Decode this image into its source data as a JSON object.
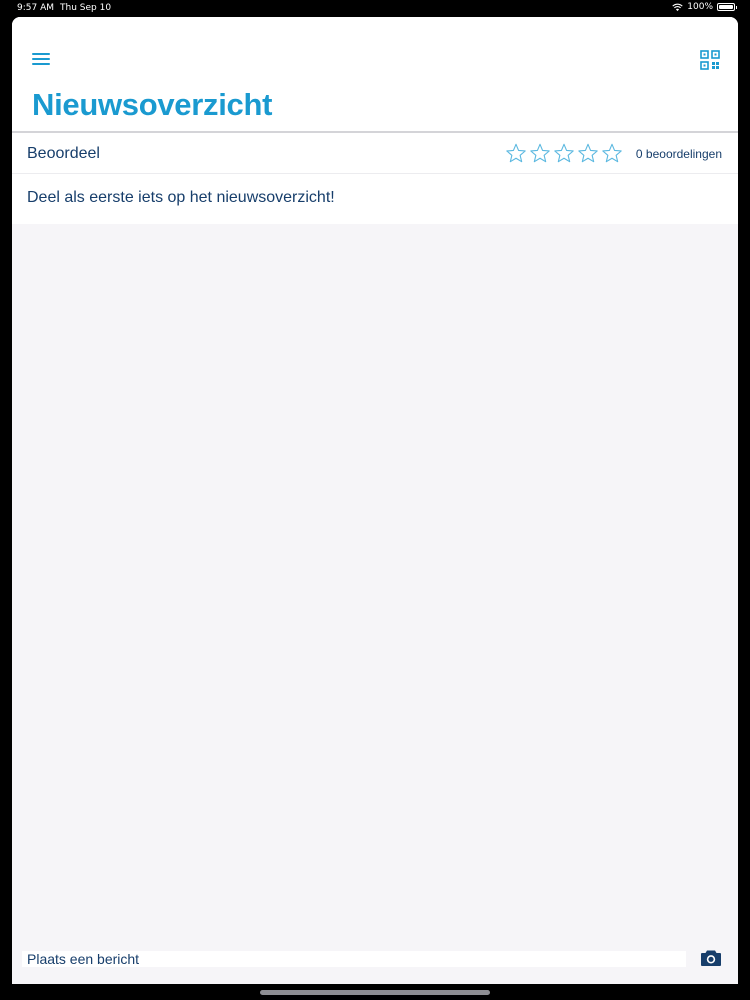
{
  "status_bar": {
    "time": "9:57 AM",
    "date": "Thu Sep 10",
    "battery": "100%",
    "battery_level": 1.0
  },
  "header": {
    "title": "Nieuwsoverzicht",
    "menu_icon": "hamburger-menu-icon",
    "qr_icon": "qr-code-icon"
  },
  "rating": {
    "label": "Beoordeel",
    "stars_filled": 0,
    "stars_total": 5,
    "count_text": "0 beoordelingen"
  },
  "feed": {
    "empty_message": "Deel als eerste iets op het nieuwsoverzicht!"
  },
  "compose": {
    "placeholder": "Plaats een bericht",
    "value": "",
    "camera_icon": "camera-icon"
  },
  "colors": {
    "accent": "#1a9ad0",
    "text_dark": "#173e6b",
    "background": "#f6f5f8"
  }
}
